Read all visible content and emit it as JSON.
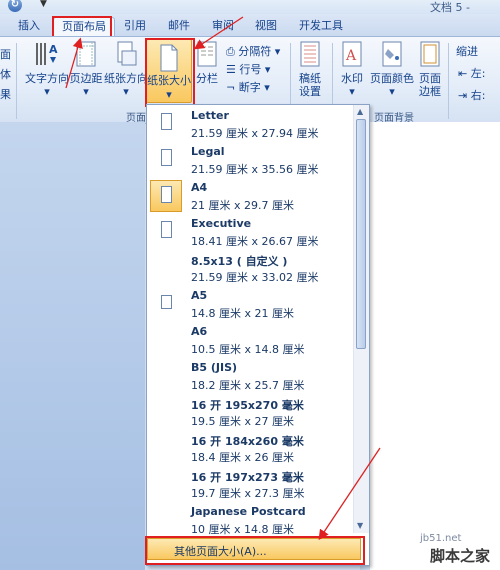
{
  "titlebar": {
    "undo_icon": "↻",
    "qa_dropdown": "▼",
    "doc_title": "文档 5 -"
  },
  "tabs": [
    {
      "label": "插入"
    },
    {
      "label": "页面布局"
    },
    {
      "label": "引用"
    },
    {
      "label": "邮件"
    },
    {
      "label": "审阅"
    },
    {
      "label": "视图"
    },
    {
      "label": "开发工具"
    }
  ],
  "ribbon": {
    "left_edge_labels": [
      "面",
      "体",
      "果"
    ],
    "text_direction": "文字方向",
    "margins": "页边距",
    "orientation": "纸张方向",
    "size": "纸张大小",
    "columns": "分栏",
    "breaks": "分隔符",
    "line_numbers": "行号",
    "hyphenation": "断字",
    "manuscript_1": "稿纸",
    "manuscript_2": "设置",
    "watermark": "水印",
    "page_color": "页面颜色",
    "page_border_1": "页面",
    "page_border_2": "边框",
    "indent": "缩进",
    "indent_left": "左:",
    "indent_right": "右:",
    "group_page_setup": "页面",
    "group_page_background": "页面背景",
    "dropdown_arrow": "▾"
  },
  "paper_sizes": [
    {
      "name": "Letter",
      "dims": "21.59 厘米 x 27.94 厘米",
      "icon": true
    },
    {
      "name": "Legal",
      "dims": "21.59 厘米 x 35.56 厘米",
      "icon": true
    },
    {
      "name": "A4",
      "dims": "21 厘米 x 29.7 厘米",
      "icon": true
    },
    {
      "name": "Executive",
      "dims": "18.41 厘米 x 26.67 厘米",
      "icon": true
    },
    {
      "name": "8.5x13 ( 自定义 )",
      "dims": "21.59 厘米 x 33.02 厘米",
      "icon": false
    },
    {
      "name": "A5",
      "dims": "14.8 厘米 x 21 厘米",
      "icon": true
    },
    {
      "name": "A6",
      "dims": "10.5 厘米 x 14.8 厘米",
      "icon": false
    },
    {
      "name": "B5 (JIS)",
      "dims": "18.2 厘米 x 25.7 厘米",
      "icon": false
    },
    {
      "name": "16 开 195x270 毫米",
      "dims": "19.5 厘米 x 27 厘米",
      "icon": false
    },
    {
      "name": "16 开 184x260 毫米",
      "dims": "18.4 厘米 x 26 厘米",
      "icon": false
    },
    {
      "name": "16 开 197x273 毫米",
      "dims": "19.7 厘米 x 27.3 厘米",
      "icon": false
    },
    {
      "name": "Japanese Postcard",
      "dims": "10 厘米 x 14.8 厘米",
      "icon": false
    }
  ],
  "selected_size": "A4",
  "more_sizes_label": "其他页面大小(A)...",
  "scroll_up": "▲",
  "scroll_down": "▼",
  "watermark": {
    "url": "jb51.net",
    "text": "脚本之家"
  },
  "colors": {
    "highlight": "#f9c85f",
    "annotation_red": "#e02020",
    "ribbon_text": "#15428b"
  }
}
